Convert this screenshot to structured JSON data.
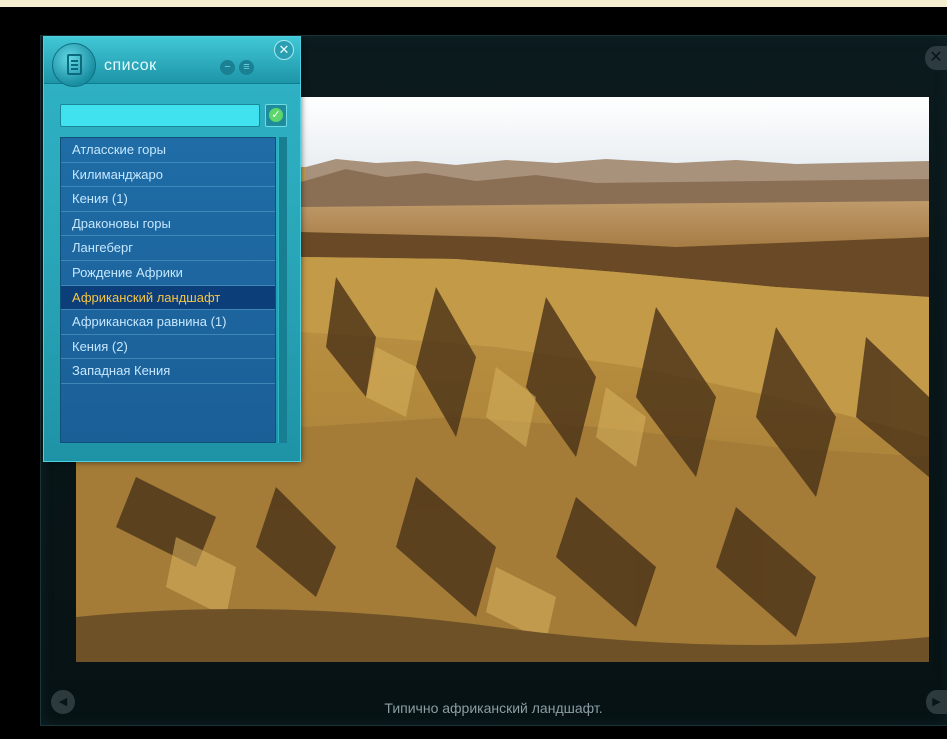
{
  "list_panel": {
    "title": "список",
    "search": {
      "value": "",
      "placeholder": ""
    },
    "items": [
      "Атласские горы",
      "Килиманджаро",
      "Кения (1)",
      "Драконовы горы",
      "Лангеберг",
      "Рождение Африки",
      "Африканский ландшафт",
      "Африканская равнина (1)",
      "Кения (2)",
      "Западная Кения"
    ],
    "selected_index": 6,
    "icons": {
      "logo": "document-icon",
      "minimize": "minus-icon",
      "menu": "list-icon",
      "close": "close-icon",
      "confirm": "checkmark-icon"
    }
  },
  "viewer": {
    "caption": "Типично африканский ландшафт.",
    "icons": {
      "close": "close-icon",
      "prev": "arrow-left-icon",
      "next": "arrow-right-icon"
    }
  },
  "colors": {
    "panel_accent": "#2aa8ba",
    "list_bg": "#1f6ca6",
    "selected_text": "#f6c544",
    "caption_text": "#8a9ea3"
  }
}
